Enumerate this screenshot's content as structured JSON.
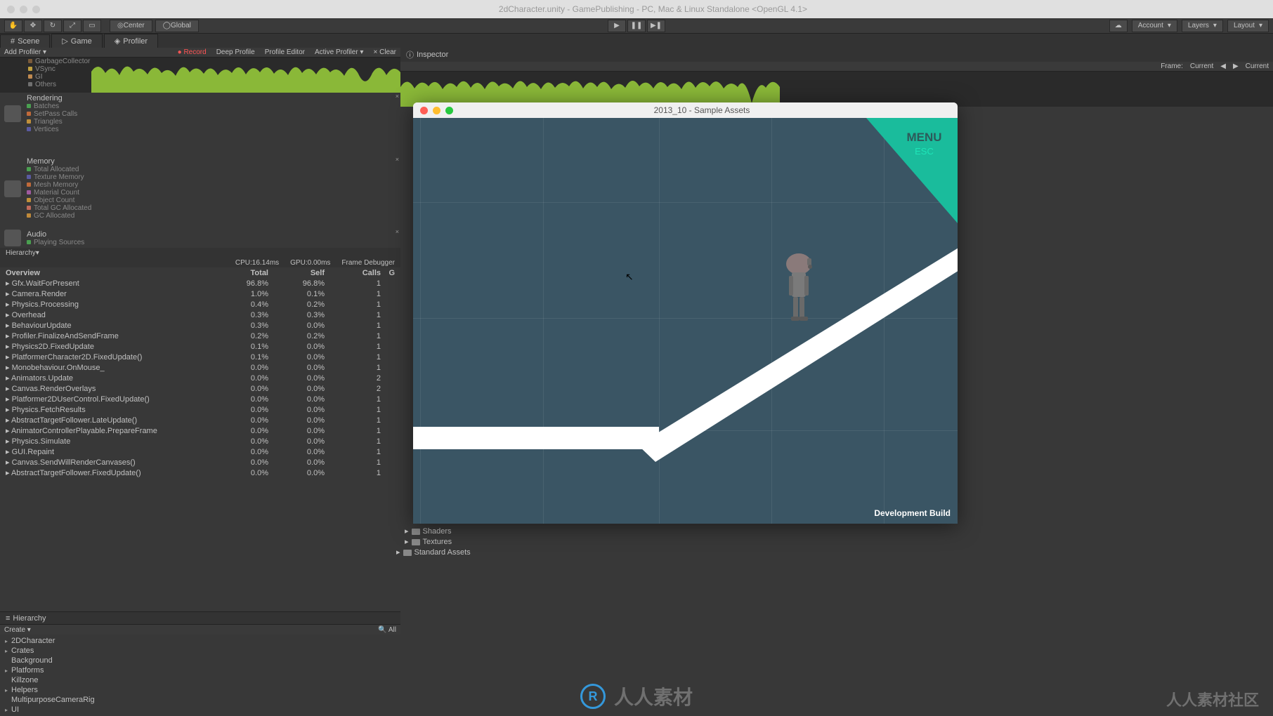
{
  "titlebar": "2dCharacter.unity - GamePublishing - PC, Mac & Linux Standalone <OpenGL 4.1>",
  "toolbar": {
    "center": "Center",
    "global": "Global",
    "account": "Account",
    "layers": "Layers",
    "layout": "Layout"
  },
  "tabs": {
    "scene": "Scene",
    "game": "Game",
    "profiler": "Profiler",
    "inspector": "Inspector"
  },
  "profiler_bar": {
    "add_profiler": "Add Profiler",
    "record": "Record",
    "deep_profile": "Deep Profile",
    "profile_editor": "Profile Editor",
    "active_profiler": "Active Profiler",
    "clear": "Clear",
    "frame": "Frame:",
    "current_val": "Current",
    "current": "Current"
  },
  "sections": {
    "cpu_items": [
      "GarbageCollector",
      "VSync",
      "GI",
      "Others"
    ],
    "rendering": "Rendering",
    "rendering_items": [
      "Batches",
      "SetPass Calls",
      "Triangles",
      "Vertices"
    ],
    "memory": "Memory",
    "memory_items": [
      "Total Allocated",
      "Texture Memory",
      "Mesh Memory",
      "Material Count",
      "Object Count",
      "Total GC Allocated",
      "GC Allocated"
    ],
    "audio": "Audio",
    "audio_items": [
      "Playing Sources"
    ]
  },
  "stats": {
    "cpu": "CPU:16.14ms",
    "gpu": "GPU:0.00ms",
    "frame_debugger": "Frame Debugger"
  },
  "overview": {
    "title": "Overview",
    "cols": [
      "Total",
      "Self",
      "Calls",
      "G"
    ],
    "rows": [
      {
        "name": "Gfx.WaitForPresent",
        "total": "96.8%",
        "self": "96.8%",
        "calls": "1"
      },
      {
        "name": "Camera.Render",
        "total": "1.0%",
        "self": "0.1%",
        "calls": "1"
      },
      {
        "name": "Physics.Processing",
        "total": "0.4%",
        "self": "0.2%",
        "calls": "1"
      },
      {
        "name": "Overhead",
        "total": "0.3%",
        "self": "0.3%",
        "calls": "1"
      },
      {
        "name": "BehaviourUpdate",
        "total": "0.3%",
        "self": "0.0%",
        "calls": "1"
      },
      {
        "name": "Profiler.FinalizeAndSendFrame",
        "total": "0.2%",
        "self": "0.2%",
        "calls": "1"
      },
      {
        "name": "Physics2D.FixedUpdate",
        "total": "0.1%",
        "self": "0.0%",
        "calls": "1"
      },
      {
        "name": "PlatformerCharacter2D.FixedUpdate()",
        "total": "0.1%",
        "self": "0.0%",
        "calls": "1"
      },
      {
        "name": "Monobehaviour.OnMouse_",
        "total": "0.0%",
        "self": "0.0%",
        "calls": "1"
      },
      {
        "name": "Animators.Update",
        "total": "0.0%",
        "self": "0.0%",
        "calls": "2"
      },
      {
        "name": "Canvas.RenderOverlays",
        "total": "0.0%",
        "self": "0.0%",
        "calls": "2"
      },
      {
        "name": "Platformer2DUserControl.FixedUpdate()",
        "total": "0.0%",
        "self": "0.0%",
        "calls": "1"
      },
      {
        "name": "Physics.FetchResults",
        "total": "0.0%",
        "self": "0.0%",
        "calls": "1"
      },
      {
        "name": "AbstractTargetFollower.LateUpdate()",
        "total": "0.0%",
        "self": "0.0%",
        "calls": "1"
      },
      {
        "name": "AnimatorControllerPlayable.PrepareFrame",
        "total": "0.0%",
        "self": "0.0%",
        "calls": "1"
      },
      {
        "name": "Physics.Simulate",
        "total": "0.0%",
        "self": "0.0%",
        "calls": "1"
      },
      {
        "name": "GUI.Repaint",
        "total": "0.0%",
        "self": "0.0%",
        "calls": "1"
      },
      {
        "name": "Canvas.SendWillRenderCanvases()",
        "total": "0.0%",
        "self": "0.0%",
        "calls": "1"
      },
      {
        "name": "AbstractTargetFollower.FixedUpdate()",
        "total": "0.0%",
        "self": "0.0%",
        "calls": "1"
      }
    ]
  },
  "hierarchy_label": "Hierarchy",
  "hierarchy": {
    "title": "Hierarchy",
    "create": "Create",
    "all": "All",
    "items": [
      {
        "name": "2DCharacter",
        "exp": true
      },
      {
        "name": "Crates",
        "exp": true
      },
      {
        "name": "Background",
        "exp": false
      },
      {
        "name": "Platforms",
        "exp": true
      },
      {
        "name": "Killzone",
        "exp": false
      },
      {
        "name": "Helpers",
        "exp": true
      },
      {
        "name": "MultipurposeCameraRig",
        "exp": false
      },
      {
        "name": "UI",
        "exp": true
      }
    ]
  },
  "project": {
    "shaders": "Shaders",
    "textures": "Textures",
    "standard_assets": "Standard Assets"
  },
  "game_window": {
    "title": "2013_10 - Sample Assets",
    "menu": "MENU",
    "esc": "ESC",
    "dev_build": "Development Build"
  },
  "watermark": {
    "main": "人人素材",
    "side": "人人素材社区"
  }
}
